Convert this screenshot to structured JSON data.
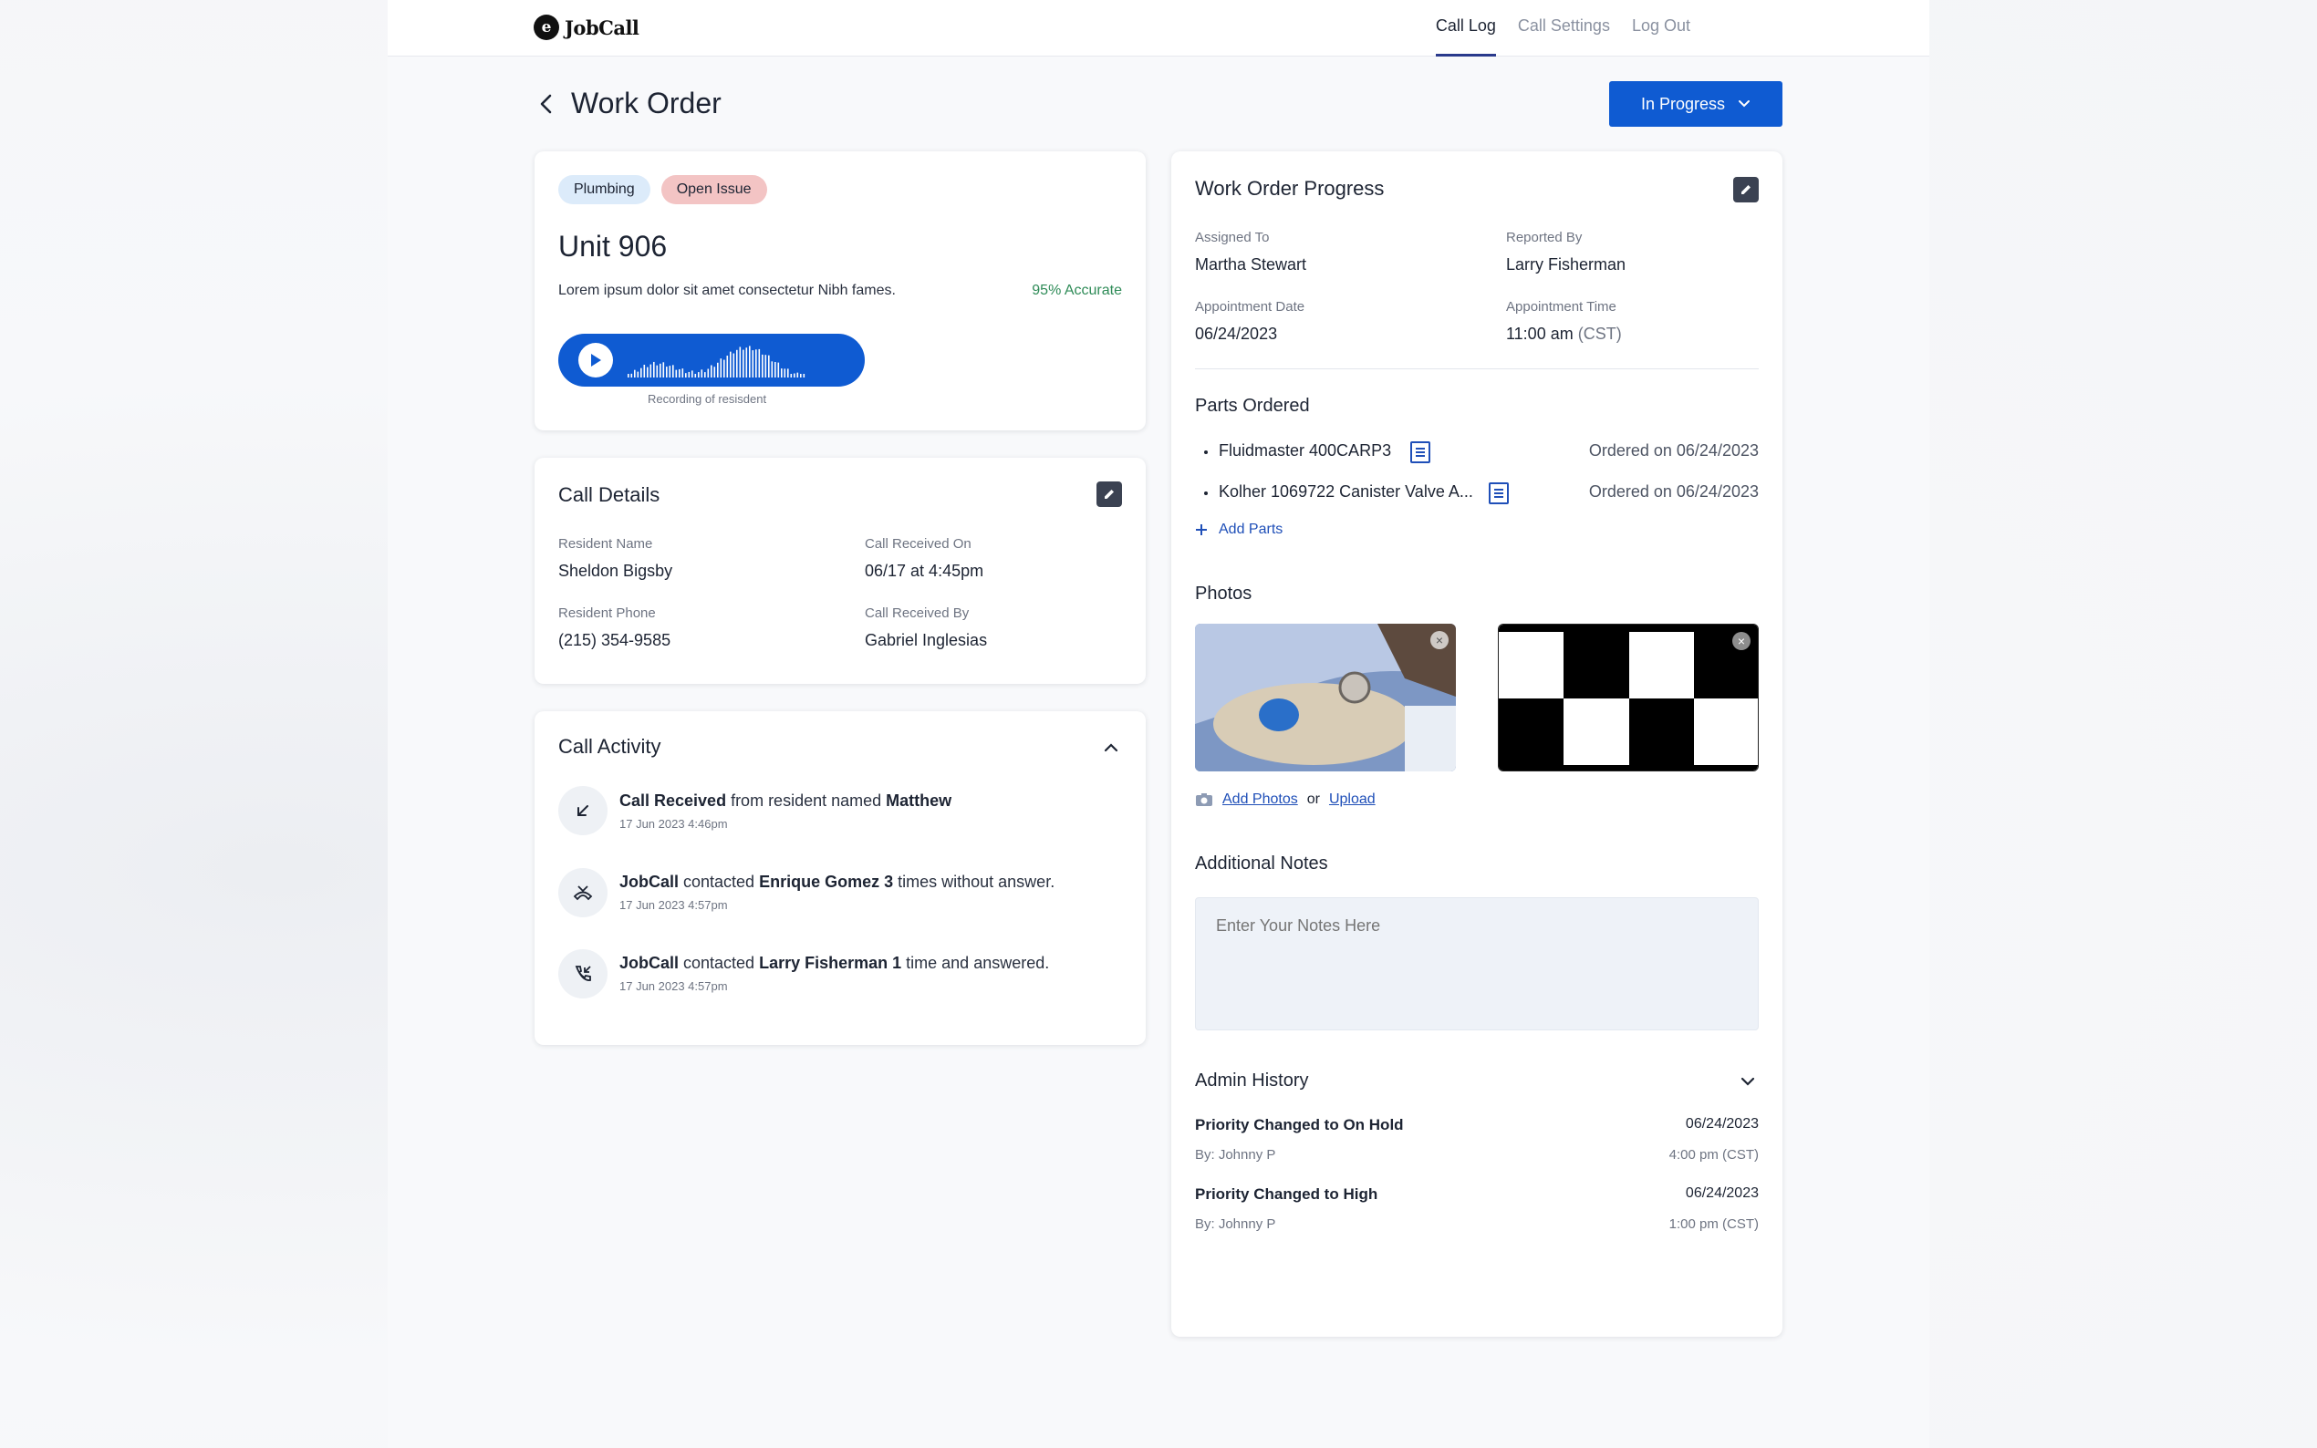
{
  "app": {
    "name": "JobCall"
  },
  "nav": {
    "items": [
      "Call Log",
      "Call Settings",
      "Log Out"
    ]
  },
  "header": {
    "title": "Work Order",
    "status": "In Progress"
  },
  "unit_card": {
    "tags": [
      "Plumbing",
      "Open Issue"
    ],
    "unit": "Unit 906",
    "summary": "Lorem ipsum dolor sit amet consectetur Nibh fames.",
    "accuracy": "95% Accurate",
    "recording_caption": "Recording of resisdent"
  },
  "call_details": {
    "title": "Call Details",
    "fields": [
      {
        "label": "Resident Name",
        "value": "Sheldon Bigsby"
      },
      {
        "label": "Call Received On",
        "value": "06/17 at 4:45pm"
      },
      {
        "label": "Resident Phone",
        "value": "(215) 354-9585"
      },
      {
        "label": "Call Received By",
        "value": "Gabriel Inglesias"
      }
    ]
  },
  "call_activity": {
    "title": "Call Activity",
    "items": [
      {
        "icon": "incoming-call-icon",
        "bold1": "Call Received",
        "text1": " from resident named ",
        "bold2": "Matthew",
        "text2": "",
        "time": "17 Jun 2023 4:46pm"
      },
      {
        "icon": "missed-call-icon",
        "bold1": "JobCall",
        "text1": " contacted ",
        "bold2": "Enrique Gomez 3",
        "text2": " times without answer.",
        "time": "17 Jun 2023 4:57pm"
      },
      {
        "icon": "answered-call-icon",
        "bold1": "JobCall",
        "text1": " contacted ",
        "bold2": "Larry Fisherman 1",
        "text2": " time and answered.",
        "time": "17 Jun 2023 4:57pm"
      }
    ]
  },
  "progress": {
    "title": "Work Order Progress",
    "fields": [
      {
        "label": "Assigned To",
        "value": "Martha Stewart"
      },
      {
        "label": "Reported By",
        "value": "Larry Fisherman"
      },
      {
        "label": "Appointment Date",
        "value": "06/24/2023"
      },
      {
        "label": "Appointment Time",
        "value": "11:00 am",
        "suffix": "(CST)"
      }
    ],
    "parts_title": "Parts Ordered",
    "parts": [
      {
        "name": "Fluidmaster 400CARP3",
        "ordered": "Ordered on 06/24/2023"
      },
      {
        "name": "Kolher 1069722 Canister Valve A...",
        "ordered": "Ordered on 06/24/2023"
      }
    ],
    "add_parts": "Add Parts",
    "photos_title": "Photos",
    "add_photos": "Add Photos",
    "or": "or",
    "upload": "Upload",
    "notes_title": "Additional Notes",
    "notes_placeholder": "Enter Your Notes Here",
    "admin_title": "Admin History",
    "history": [
      {
        "title": "Priority Changed to On Hold",
        "by": "By: Johnny P",
        "date": "06/24/2023",
        "time": "4:00 pm (CST)"
      },
      {
        "title": "Priority Changed to High",
        "by": "By: Johnny P",
        "date": "06/24/2023",
        "time": "1:00 pm (CST)"
      }
    ]
  },
  "colors": {
    "primary": "#0f5bd2",
    "accuracy": "#2e8b57",
    "tag_plumbing": "#dcebfa",
    "tag_issue": "#f3c4c4"
  }
}
